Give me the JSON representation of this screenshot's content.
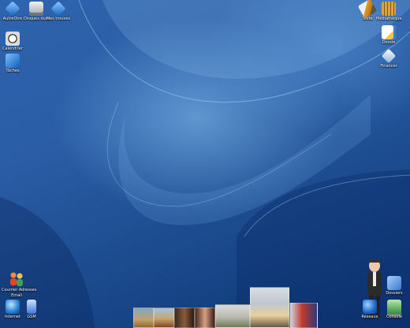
{
  "desktop": {
    "icons_left": [
      {
        "label": "AutreOtre",
        "icon": "cube-icon"
      },
      {
        "label": "Disques durs",
        "icon": "drive-icon"
      },
      {
        "label": "Mes trouves",
        "icon": "cube-icon"
      },
      {
        "label": "Calendrier",
        "icon": "clock-icon"
      },
      {
        "label": "Tâches",
        "icon": "checklist-icon"
      }
    ],
    "icons_right": [
      {
        "label": "Texte",
        "icon": "pen-icon"
      },
      {
        "label": "Médiathèque",
        "icon": "film-icon"
      },
      {
        "label": "Dossie",
        "icon": "document-icon"
      },
      {
        "label": "Financer",
        "icon": "diamond-icon"
      }
    ],
    "icons_bottom_left": [
      {
        "label": "Courrier Adresses",
        "icon": "people-icon"
      },
      {
        "label": "Email",
        "icon": "mail-icon"
      },
      {
        "label": "Internet",
        "icon": "globe-icon"
      },
      {
        "label": "GSM",
        "icon": "phone-icon"
      }
    ],
    "icons_bottom_right": [
      {
        "label": "Dossiers",
        "icon": "box-icon"
      },
      {
        "label": "Réseaux",
        "icon": "network-icon"
      },
      {
        "label": "Console",
        "icon": "screen-icon"
      }
    ]
  },
  "colors": {
    "wallpaper_dark": "#0d3470",
    "wallpaper_light": "#8cc8f5",
    "label_text": "#ffffff"
  }
}
